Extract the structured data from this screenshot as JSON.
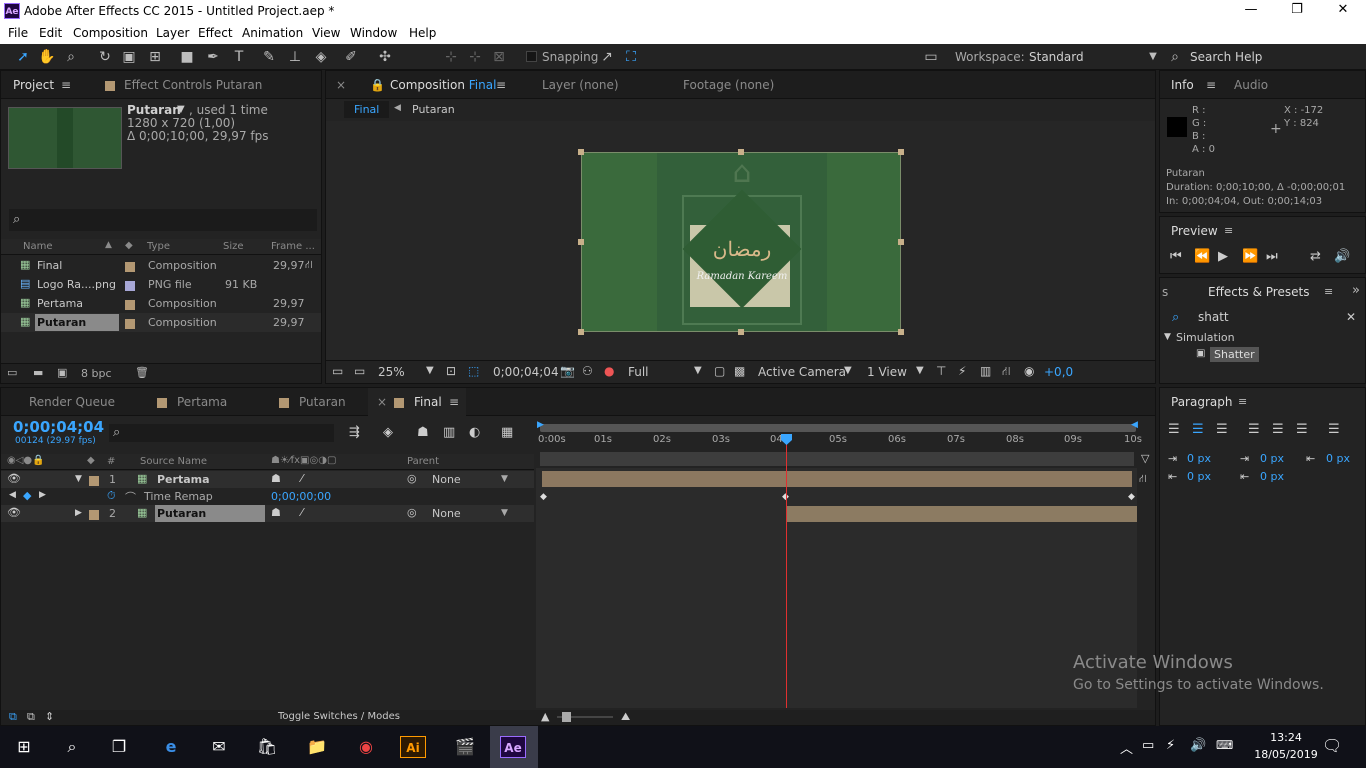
{
  "window": {
    "title": "Adobe After Effects CC 2015 - Untitled Project.aep *",
    "app_badge": "Ae"
  },
  "menu": [
    "File",
    "Edit",
    "Composition",
    "Layer",
    "Effect",
    "Animation",
    "View",
    "Window",
    "Help"
  ],
  "toolbar": {
    "snapping": "Snapping",
    "workspace_label": "Workspace:",
    "workspace_value": "Standard",
    "search_help": "Search Help"
  },
  "project": {
    "tab": "Project",
    "tab2": "Effect Controls Putaran",
    "item_name": "Putaran",
    "item_used": ", used 1 time",
    "item_res": "1280 x 720 (1,00)",
    "item_dur": "Δ 0;00;10;00, 29,97 fps",
    "cols": [
      "Name",
      "Type",
      "Size",
      "Frame ..."
    ],
    "rows": [
      {
        "name": "Final",
        "type": "Composition",
        "size": "",
        "fr": "29,97"
      },
      {
        "name": "Logo Ra....png",
        "type": "PNG file",
        "size": "91 KB",
        "fr": ""
      },
      {
        "name": "Pertama",
        "type": "Composition",
        "size": "",
        "fr": "29,97"
      },
      {
        "name": "Putaran",
        "type": "Composition",
        "size": "",
        "fr": "29,97"
      }
    ],
    "bpc": "8 bpc"
  },
  "comp": {
    "tab_prefix": "Composition",
    "tab_name": "Final",
    "layer_tab": "Layer (none)",
    "footage_tab": "Footage (none)",
    "crumb1": "Final",
    "crumb2": "Putaran",
    "zoom": "25%",
    "timecode": "0;00;04;04",
    "res": "Full",
    "camera": "Active Camera",
    "views": "1 View",
    "exposure": "+0,0",
    "arabic": "رمضان",
    "greeting": "Ramadan Kareem"
  },
  "info": {
    "tab": "Info",
    "tab2": "Audio",
    "r": "R :",
    "g": "G :",
    "b": "B :",
    "a": "A : 0",
    "x": "X : -172",
    "y": "Y : 824",
    "name": "Putaran",
    "duration": "Duration: 0;00;10;00, Δ -0;00;00;01",
    "inout": "In: 0;00;04;04, Out: 0;00;14;03"
  },
  "preview": {
    "tab": "Preview"
  },
  "effects": {
    "tab": "Effects & Presets",
    "tab_prev": "s",
    "search": "shatt",
    "category": "Simulation",
    "item": "Shatter"
  },
  "paragraph": {
    "tab": "Paragraph",
    "v1": "0 px",
    "v2": "0 px",
    "v3": "0 px",
    "v4": "0 px",
    "v5": "0 px"
  },
  "timeline": {
    "tabs": [
      "Render Queue",
      "Pertama",
      "Putaran",
      "Final"
    ],
    "time": "0;00;04;04",
    "frames": "00124 (29.97 fps)",
    "col_num": "#",
    "col_source": "Source Name",
    "col_parent": "Parent",
    "ruler": [
      "0:00s",
      "01s",
      "02s",
      "03s",
      "04s",
      "05s",
      "06s",
      "07s",
      "08s",
      "09s",
      "10s"
    ],
    "layers": [
      {
        "num": "1",
        "name": "Pertama",
        "parent": "None"
      },
      {
        "num": "2",
        "name": "Putaran",
        "parent": "None"
      }
    ],
    "prop": "Time Remap",
    "prop_val": "0;00;00;00",
    "toggle": "Toggle Switches / Modes"
  },
  "watermark": {
    "line1": "Activate Windows",
    "line2": "Go to Settings to activate Windows."
  },
  "taskbar": {
    "time": "13:24",
    "date": "18/05/2019"
  }
}
